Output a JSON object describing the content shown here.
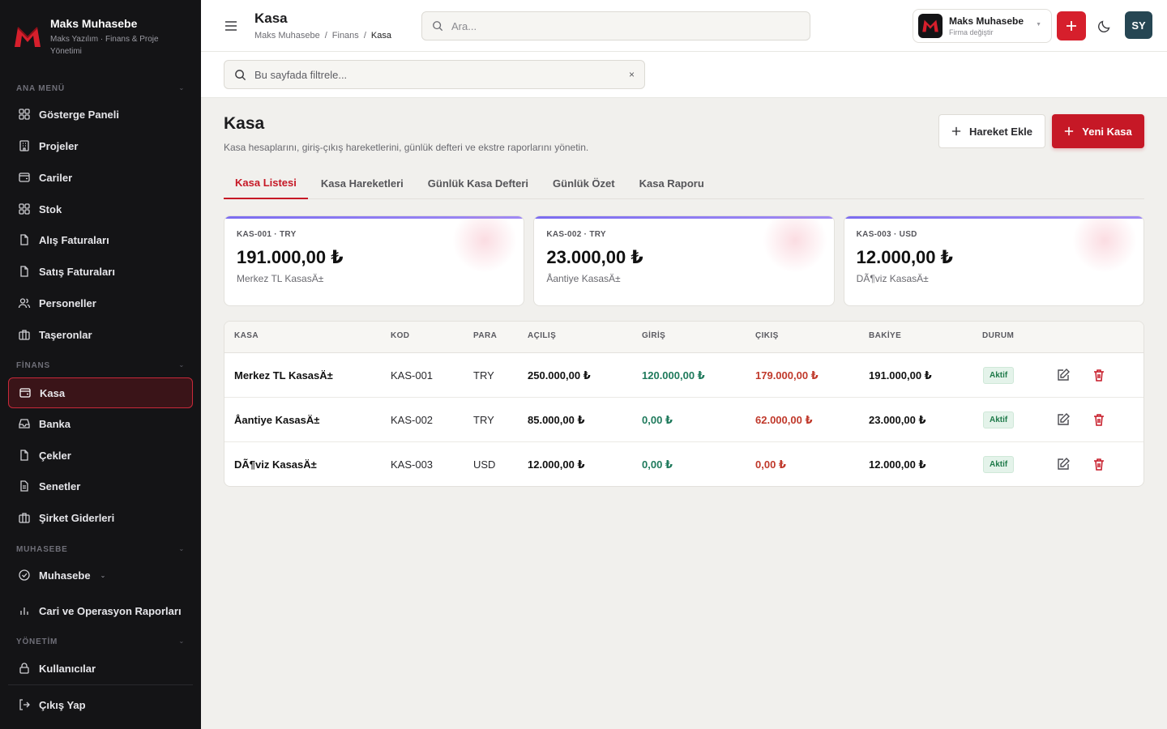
{
  "sidebar": {
    "brand_title": "Maks Muhasebe",
    "brand_subtitle": "Maks Yazılım · Finans & Proje Yönetimi",
    "sections": {
      "ana_menu": "ANA MENÜ",
      "finans": "FİNANS",
      "muhasebe": "MUHASEBE",
      "yonetim": "YÖNETİM"
    },
    "items": {
      "gosterge": "Gösterge Paneli",
      "projeler": "Projeler",
      "cariler": "Cariler",
      "stok": "Stok",
      "alis": "Alış Faturaları",
      "satis": "Satış Faturaları",
      "personeller": "Personeller",
      "taseronlar": "Taşeronlar",
      "kasa": "Kasa",
      "banka": "Banka",
      "cekler": "Çekler",
      "senetler": "Senetler",
      "sirket_giderleri": "Şirket Giderleri",
      "muhasebe": "Muhasebe",
      "raporlar": "Cari ve Operasyon Raporları",
      "kullanicilar": "Kullanıcılar",
      "cikis": "Çıkış Yap"
    }
  },
  "header": {
    "title": "Kasa",
    "breadcrumb": [
      "Maks Muhasebe",
      "/",
      "Finans",
      "/",
      "Kasa"
    ],
    "search_placeholder": "Ara...",
    "company_name": "Maks Muhasebe",
    "company_sub": "Firma değiştir",
    "avatar_initials": "SY"
  },
  "filter": {
    "placeholder": "Bu sayfada filtrele...",
    "clear": "×"
  },
  "main": {
    "title": "Kasa",
    "description": "Kasa hesaplarını, giriş-çıkış hareketlerini, günlük defteri ve ekstre raporlarını yönetin.",
    "btn_hareket": "Hareket Ekle",
    "btn_yeni": "Yeni Kasa",
    "tabs": [
      "Kasa Listesi",
      "Kasa Hareketleri",
      "Günlük Kasa Defteri",
      "Günlük Özet",
      "Kasa Raporu"
    ],
    "active_tab": "Kasa Listesi"
  },
  "cards": [
    {
      "code": "KAS-001 · TRY",
      "amount": "191.000,00 ₺",
      "name": "Merkez TL KasasÄ±"
    },
    {
      "code": "KAS-002 · TRY",
      "amount": "23.000,00 ₺",
      "name": "Å\u001eantiye KasasÄ±"
    },
    {
      "code": "KAS-003 · USD",
      "amount": "12.000,00 ₺",
      "name": "DÃ¶viz KasasÄ±"
    }
  ],
  "table": {
    "headers": {
      "kasa": "KASA",
      "kod": "KOD",
      "para": "PARA",
      "acilis": "AÇILIŞ",
      "giris": "GİRİŞ",
      "cikis": "ÇIKIŞ",
      "bakiye": "BAKİYE",
      "durum": "DURUM"
    },
    "rows": [
      {
        "kasa": "Merkez TL KasasÄ±",
        "kod": "KAS-001",
        "para": "TRY",
        "acilis": "250.000,00 ₺",
        "giris": "120.000,00 ₺",
        "cikis": "179.000,00 ₺",
        "bakiye": "191.000,00 ₺",
        "durum": "Aktif"
      },
      {
        "kasa": "Å\u001eantiye KasasÄ±",
        "kod": "KAS-002",
        "para": "TRY",
        "acilis": "85.000,00 ₺",
        "giris": "0,00 ₺",
        "cikis": "62.000,00 ₺",
        "bakiye": "23.000,00 ₺",
        "durum": "Aktif"
      },
      {
        "kasa": "DÃ¶viz KasasÄ±",
        "kod": "KAS-003",
        "para": "USD",
        "acilis": "12.000,00 ₺",
        "giris": "0,00 ₺",
        "cikis": "0,00 ₺",
        "bakiye": "12.000,00 ₺",
        "durum": "Aktif"
      }
    ]
  },
  "colors": {
    "accent": "#c61826",
    "sidebar_bg": "#141416",
    "positive": "#1f7a5c",
    "negative": "#c0392b",
    "avatar": "#264653"
  }
}
